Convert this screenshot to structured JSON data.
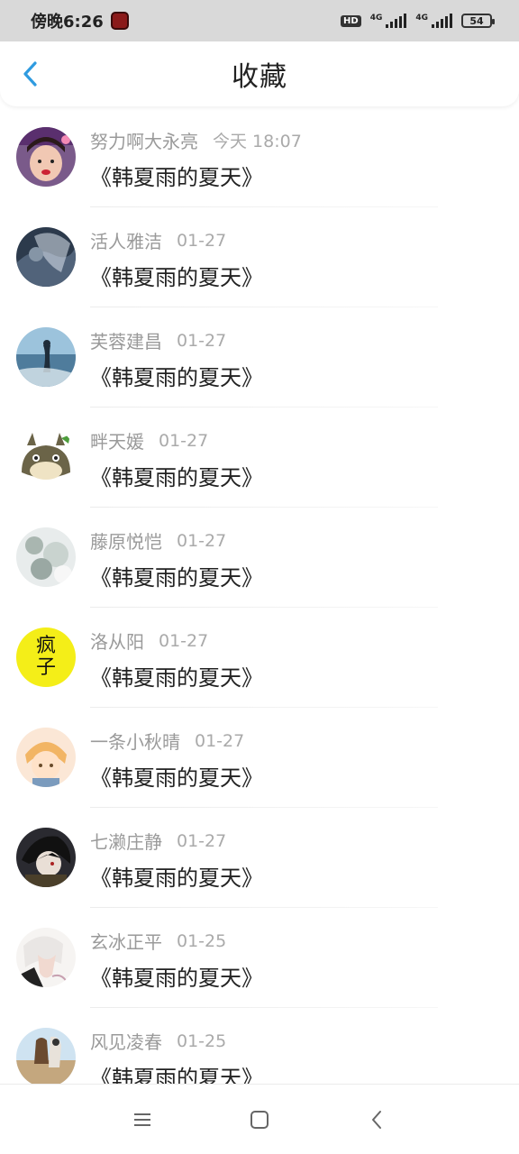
{
  "status_bar": {
    "time": "傍晚6:26",
    "hd": "HD",
    "net1": "4G",
    "net2": "4G",
    "battery": "54"
  },
  "header": {
    "title": "收藏"
  },
  "favorites": [
    {
      "name": "努力啊大永亮",
      "time": "今天 18:07",
      "title": "《韩夏雨的夏天》",
      "avatar_text": ""
    },
    {
      "name": "活人雅洁",
      "time": "01-27",
      "title": "《韩夏雨的夏天》",
      "avatar_text": ""
    },
    {
      "name": "芙蓉建昌",
      "time": "01-27",
      "title": "《韩夏雨的夏天》",
      "avatar_text": ""
    },
    {
      "name": "畔天媛",
      "time": "01-27",
      "title": "《韩夏雨的夏天》",
      "avatar_text": ""
    },
    {
      "name": "藤原悦恺",
      "time": "01-27",
      "title": "《韩夏雨的夏天》",
      "avatar_text": ""
    },
    {
      "name": "洛从阳",
      "time": "01-27",
      "title": "《韩夏雨的夏天》",
      "avatar_text": "疯子"
    },
    {
      "name": "一条小秋晴",
      "time": "01-27",
      "title": "《韩夏雨的夏天》",
      "avatar_text": ""
    },
    {
      "name": "七濑庄静",
      "time": "01-27",
      "title": "《韩夏雨的夏天》",
      "avatar_text": ""
    },
    {
      "name": "玄冰正平",
      "time": "01-25",
      "title": "《韩夏雨的夏天》",
      "avatar_text": ""
    },
    {
      "name": "风见凌春",
      "time": "01-25",
      "title": "《韩夏雨的夏天》",
      "avatar_text": ""
    }
  ],
  "colors": {
    "accent": "#2f9be0",
    "status_bar_bg": "#d9d9d9"
  }
}
